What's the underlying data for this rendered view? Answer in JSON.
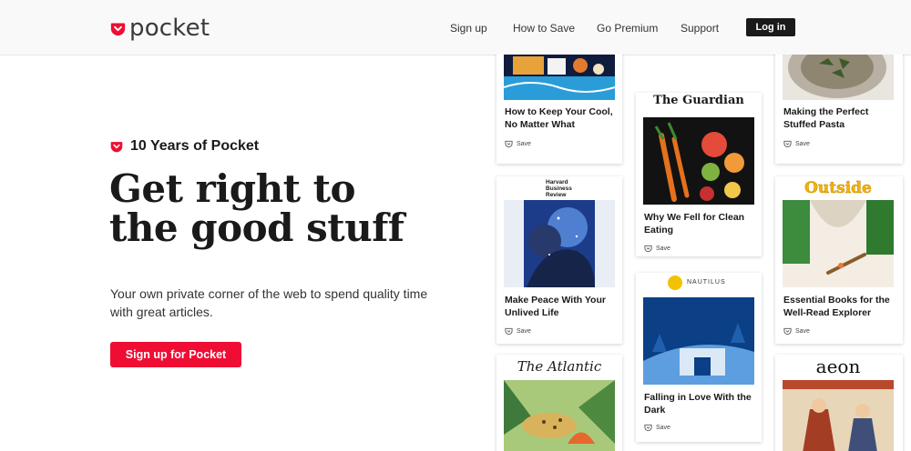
{
  "header": {
    "logo_text": "pocket",
    "nav": [
      "Sign up",
      "How to Save",
      "Go Premium",
      "Support"
    ],
    "login_label": "Log in"
  },
  "hero": {
    "eyebrow": "10 Years of Pocket",
    "headline_line1": "Get right to",
    "headline_line2": "the good stuff",
    "subhead": "Your own private corner of the web to spend quality time with great articles.",
    "cta": "Sign up for Pocket"
  },
  "cards": [
    {
      "title": "How to Keep Your Cool, No Matter What",
      "save": "Save"
    },
    {
      "publisher": "Harvard Business Review",
      "title": "Make Peace With Your Unlived Life",
      "save": "Save"
    },
    {
      "publisher": "The Atlantic"
    },
    {
      "publisher": "The Guardian",
      "title": "Why We Fell for Clean Eating",
      "save": "Save"
    },
    {
      "publisher": "NAUTILUS",
      "title": "Falling in Love With the Dark",
      "save": "Save"
    },
    {
      "title": "Making the Perfect Stuffed Pasta",
      "save": "Save"
    },
    {
      "publisher": "Outside",
      "title": "Essential Books for the Well-Read Explorer",
      "save": "Save"
    },
    {
      "publisher": "aeon"
    }
  ],
  "colors": {
    "brand_red": "#ef0d33",
    "dark": "#1a1a1a",
    "header_bg": "#f9f9fa"
  },
  "icons": [
    "pocket-logo-icon",
    "save-icon"
  ]
}
